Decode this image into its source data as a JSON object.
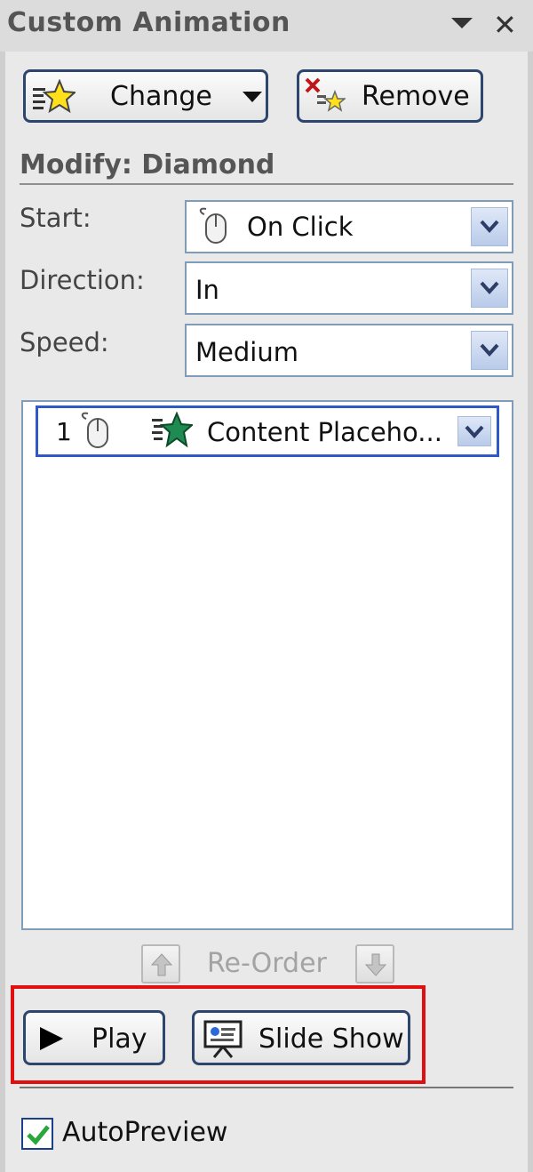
{
  "pane": {
    "title": "Custom Animation"
  },
  "toolbar": {
    "change_label": "Change",
    "remove_label": "Remove"
  },
  "modify": {
    "header": "Modify: Diamond",
    "start_label": "Start:",
    "start_value": "On Click",
    "direction_label": "Direction:",
    "direction_value": "In",
    "speed_label": "Speed:",
    "speed_value": "Medium"
  },
  "animation_list": {
    "items": [
      {
        "order": "1",
        "trigger_icon": "mouse-icon",
        "effect_icon": "star-effect-icon",
        "label": "Content Placeho..."
      }
    ]
  },
  "reorder": {
    "label": "Re-Order"
  },
  "playback": {
    "play_label": "Play",
    "slideshow_label": "Slide Show"
  },
  "autopreview": {
    "label": "AutoPreview",
    "checked": true
  },
  "colors": {
    "accent": "#2e59c6",
    "highlight": "#e01010"
  }
}
